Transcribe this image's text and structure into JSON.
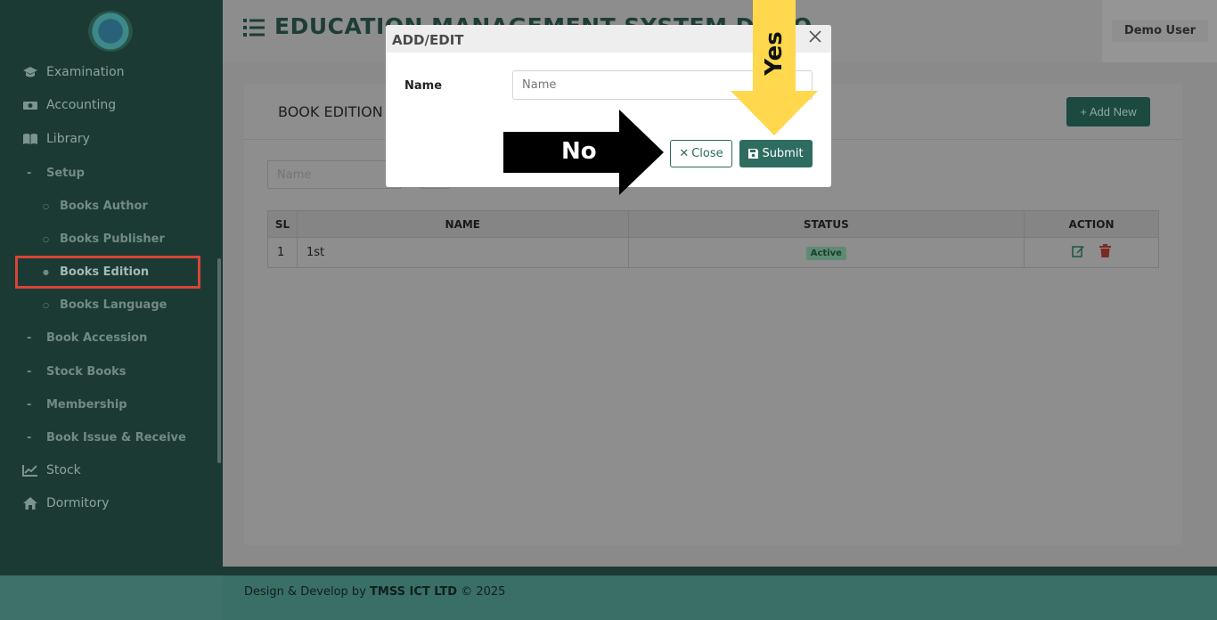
{
  "header": {
    "title": "EDUCATION MANAGEMENT SYSTEM  DEMO",
    "user": "Demo User"
  },
  "sidebar": {
    "items": [
      {
        "label": "Examination",
        "icon": "graduation-cap-icon"
      },
      {
        "label": "Accounting",
        "icon": "money-icon"
      },
      {
        "label": "Library",
        "icon": "book-open-icon"
      },
      {
        "label": "Stock",
        "icon": "chart-line-icon"
      },
      {
        "label": "Dormitory",
        "icon": "home-icon"
      }
    ],
    "library_sub": [
      "Setup",
      "Book Accession",
      "Stock Books",
      "Membership",
      "Book Issue & Receive"
    ],
    "setup_sub": [
      "Books Author",
      "Books Publisher",
      "Books Edition",
      "Books Language"
    ]
  },
  "page": {
    "card_title": "BOOK EDITION",
    "add_new": "+ Add New",
    "filter_placeholder": "Name"
  },
  "table": {
    "headers": [
      "SL",
      "NAME",
      "STATUS",
      "ACTION"
    ],
    "rows": [
      {
        "sl": "1",
        "name": "1st",
        "status": "Active"
      }
    ]
  },
  "modal": {
    "title": "ADD/EDIT",
    "field_label": "Name",
    "field_placeholder": "Name",
    "close_label": "Close",
    "submit_label": "Submit"
  },
  "annotations": {
    "no": "No",
    "yes": "Yes"
  },
  "footer": {
    "prefix": "Design & Develop by ",
    "company": "TMSS ICT LTD",
    "suffix": " © 2025"
  },
  "colors": {
    "sidebar_bg": "#1a3a33",
    "accent": "#2e6c60",
    "highlight": "#d9443a",
    "yes_arrow": "#ffd84d",
    "no_arrow": "#000000"
  }
}
